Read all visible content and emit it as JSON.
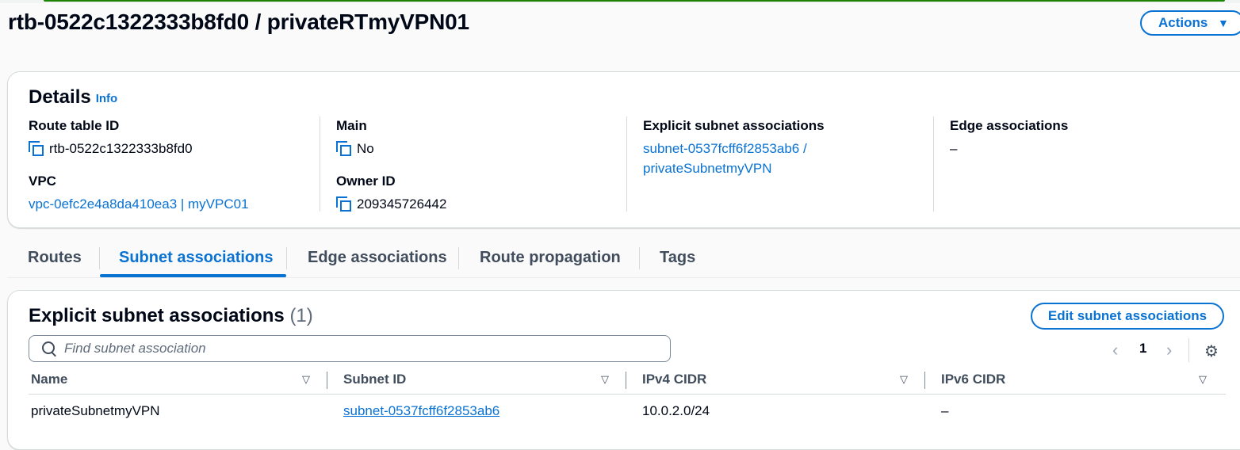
{
  "page": {
    "title": "rtb-0522c1322333b8fd0 / privateRTmyVPN01",
    "actions_label": "Actions",
    "actions_caret": "▼"
  },
  "details": {
    "title": "Details",
    "info": "Info",
    "route_table_id_label": "Route table ID",
    "route_table_id": "rtb-0522c1322333b8fd0",
    "main_label": "Main",
    "main_value": "No",
    "explicit_label": "Explicit subnet associations",
    "explicit_line1": "subnet-0537fcff6f2853ab6 /",
    "explicit_line2": "privateSubnetmyVPN",
    "edge_label": "Edge associations",
    "edge_value": "–",
    "vpc_label": "VPC",
    "vpc_value": "vpc-0efc2e4a8da410ea3 | myVPC01",
    "owner_label": "Owner ID",
    "owner_value": "209345726442"
  },
  "tabs": [
    {
      "label": "Routes"
    },
    {
      "label": "Subnet associations",
      "active": true
    },
    {
      "label": "Edge associations"
    },
    {
      "label": "Route propagation"
    },
    {
      "label": "Tags"
    }
  ],
  "assoc": {
    "title": "Explicit subnet associations",
    "count": "(1)",
    "edit_label": "Edit subnet associations",
    "search_placeholder": "Find subnet association",
    "page_number": "1",
    "prev": "‹",
    "next": "›",
    "gear": "⚙",
    "columns": [
      "Name",
      "Subnet ID",
      "IPv4 CIDR",
      "IPv6 CIDR"
    ],
    "sort_glyph": "▽",
    "rows": [
      {
        "name": "privateSubnetmyVPN",
        "subnet_id": "subnet-0537fcff6f2853ab6",
        "ipv4": "10.0.2.0/24",
        "ipv6": "–"
      }
    ]
  },
  "colors": {
    "accent": "#0972d3",
    "success_bar": "#1d8102",
    "text": "#000716"
  },
  "icons": [
    "copy-icon",
    "search-icon",
    "gear-icon",
    "caret-down-icon",
    "sort-icon",
    "chevron-left-icon",
    "chevron-right-icon"
  ]
}
